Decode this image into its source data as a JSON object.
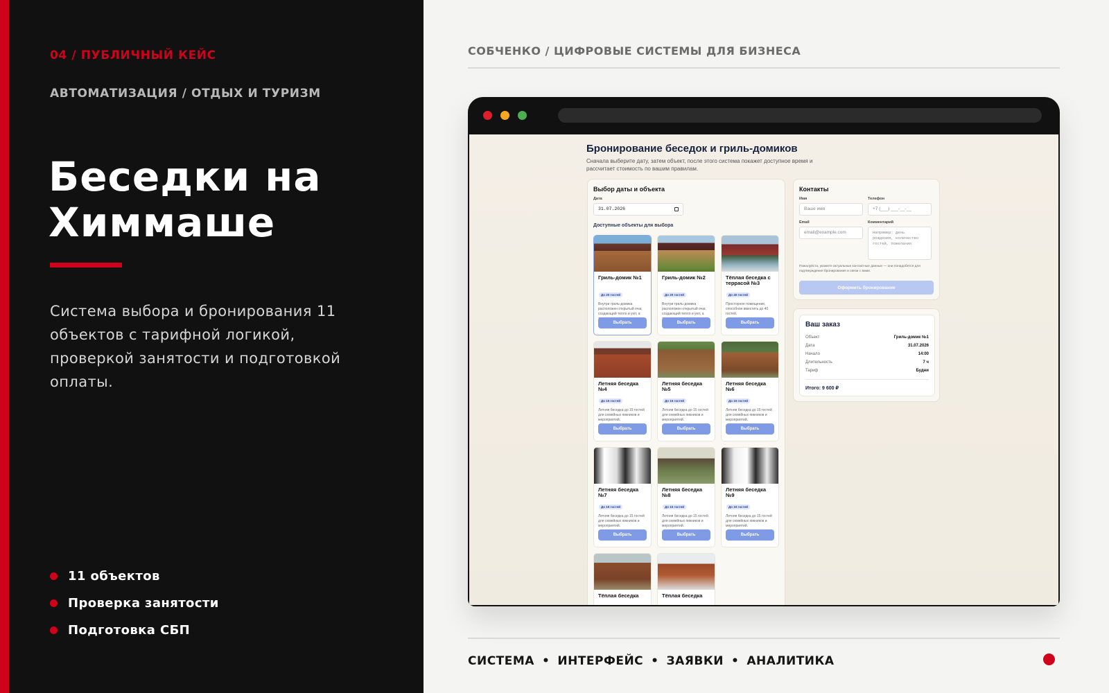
{
  "slide": {
    "kicker": "04 / ПУБЛИЧНЫЙ КЕЙС",
    "subkicker": "АВТОМАТИЗАЦИЯ / ОТДЫХ И ТУРИЗМ",
    "title": "Беседки на Химмаше",
    "description": "Система выбора и бронирования 11 объектов с тарифной логикой, проверкой занятости и подготовкой оплаты.",
    "features": [
      "11 объектов",
      "Проверка занятости",
      "Подготовка СБП"
    ],
    "brand": "СОБЧЕНКО / ЦИФРОВЫЕ СИСТЕМЫ ДЛЯ БИЗНЕСА",
    "tags": [
      "СИСТЕМА",
      "ИНТЕРФЕЙС",
      "ЗАЯВКИ",
      "АНАЛИТИКА"
    ],
    "tag_separator": "•",
    "accent_color": "#d0021b"
  },
  "app": {
    "title": "Бронирование беседок и гриль-домиков",
    "subtitle": "Сначала выберите дату, затем объект, после этого система покажет доступное время и рассчитает стоимость по вашим правилам.",
    "picker": {
      "heading": "Выбор даты и объекта",
      "date_label": "Дата",
      "date_value": "31.07.2026",
      "objects_heading": "Доступные объекты для выбора",
      "select_label": "Выбрать",
      "items": [
        {
          "name": "Гриль-домик №1",
          "badge": "До 20 гостей",
          "text": "Внутри гриль-домика расположен открытый очаг, создающий тепло и уют, а также служит в качестве мангала.",
          "selected": true,
          "photo": "wood1"
        },
        {
          "name": "Гриль-домик №2",
          "badge": "До 20 гостей",
          "text": "Внутри гриль-домика расположен открытый очаг, создающий тепло и уют, а также служит в качестве мангала.",
          "photo": "wood2"
        },
        {
          "name": "Тёплая беседка с террасой №3",
          "badge": "До 40 гостей",
          "text": "Просторное помещение, способное вместить до 40 гостей.",
          "photo": "house3"
        },
        {
          "name": "Летняя беседка №4",
          "badge": "До 15 гостей",
          "text": "Летняя беседка до 15 гостей для семейных пикников и мероприятий.",
          "photo": "gaz4"
        },
        {
          "name": "Летняя беседка №5",
          "badge": "До 15 гостей",
          "text": "Летняя беседка до 15 гостей для семейных пикников и мероприятий.",
          "photo": "gaz5"
        },
        {
          "name": "Летняя беседка №6",
          "badge": "До 15 гостей",
          "text": "Летняя беседка до 15 гостей для семейных пикников и мероприятий.",
          "photo": "gaz6"
        },
        {
          "name": "Летняя беседка №7",
          "badge": "До 15 гостей",
          "text": "Летняя беседка до 15 гостей для семейных пикников и мероприятий.",
          "photo": "gaz7"
        },
        {
          "name": "Летняя беседка №8",
          "badge": "До 15 гостей",
          "text": "Летняя беседка до 15 гостей для семейных пикников и мероприятий.",
          "photo": "gaz8"
        },
        {
          "name": "Летняя беседка №9",
          "badge": "До 15 гостей",
          "text": "Летняя беседка до 15 гостей для семейных пикников и мероприятий.",
          "photo": "gaz9"
        },
        {
          "name": "Тёплая беседка",
          "badge": "",
          "text": "",
          "photo": "warm10"
        },
        {
          "name": "Тёплая беседка",
          "badge": "",
          "text": "",
          "photo": "warm11"
        }
      ]
    },
    "contacts": {
      "heading": "Контакты",
      "name_label": "Имя",
      "name_placeholder": "Ваше имя",
      "phone_label": "Телефон",
      "phone_placeholder": "+7 (___) ___-__-__",
      "email_label": "Email",
      "email_placeholder": "email@example.com",
      "comment_label": "Комментарий",
      "comment_placeholder": "Например: день рождения, количество гостей, пожелания",
      "hint": "Пожалуйста, укажите актуальные контактные данные — они понадобятся для подтверждения бронирования и связи с вами.",
      "submit_label": "Оформить бронирование"
    },
    "order": {
      "heading": "Ваш заказ",
      "rows": [
        {
          "k": "Объект",
          "v": "Гриль-домик №1"
        },
        {
          "k": "Дата",
          "v": "31.07.2026"
        },
        {
          "k": "Начало",
          "v": "14:00"
        },
        {
          "k": "Длительность",
          "v": "7 ч"
        },
        {
          "k": "Тариф",
          "v": "Будни"
        }
      ],
      "total": "Итого: 9 600 ₽"
    }
  }
}
